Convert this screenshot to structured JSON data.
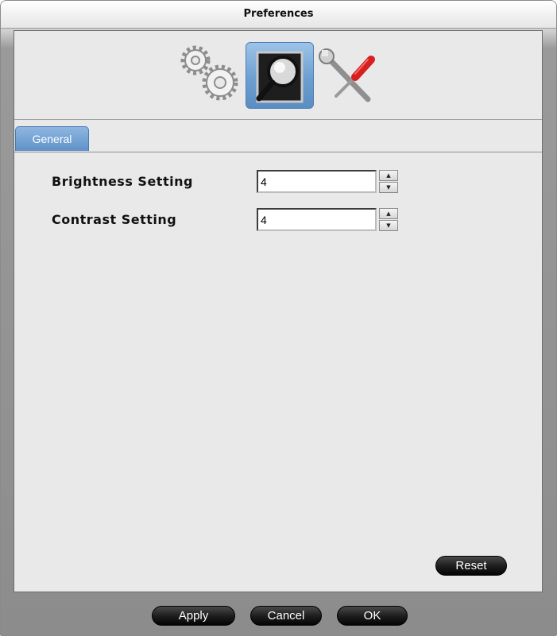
{
  "window": {
    "title": "Preferences"
  },
  "toolbar": {
    "tools": [
      {
        "icon": "gears-icon",
        "selected": false
      },
      {
        "icon": "magnifier-display-icon",
        "selected": true
      },
      {
        "icon": "wrench-screwdriver-icon",
        "selected": false
      }
    ]
  },
  "tabs": [
    {
      "label": "General",
      "selected": true
    }
  ],
  "settings": {
    "brightness": {
      "label": "Brightness Setting",
      "value": "4"
    },
    "contrast": {
      "label": "Contrast Setting",
      "value": "4"
    }
  },
  "buttons": {
    "reset": "Reset",
    "apply": "Apply",
    "cancel": "Cancel",
    "ok": "OK"
  },
  "colors": {
    "accent_tab": "#6c9fd1",
    "button_dark": "#1b1b1b",
    "panel_bg": "#e9e9e9"
  }
}
